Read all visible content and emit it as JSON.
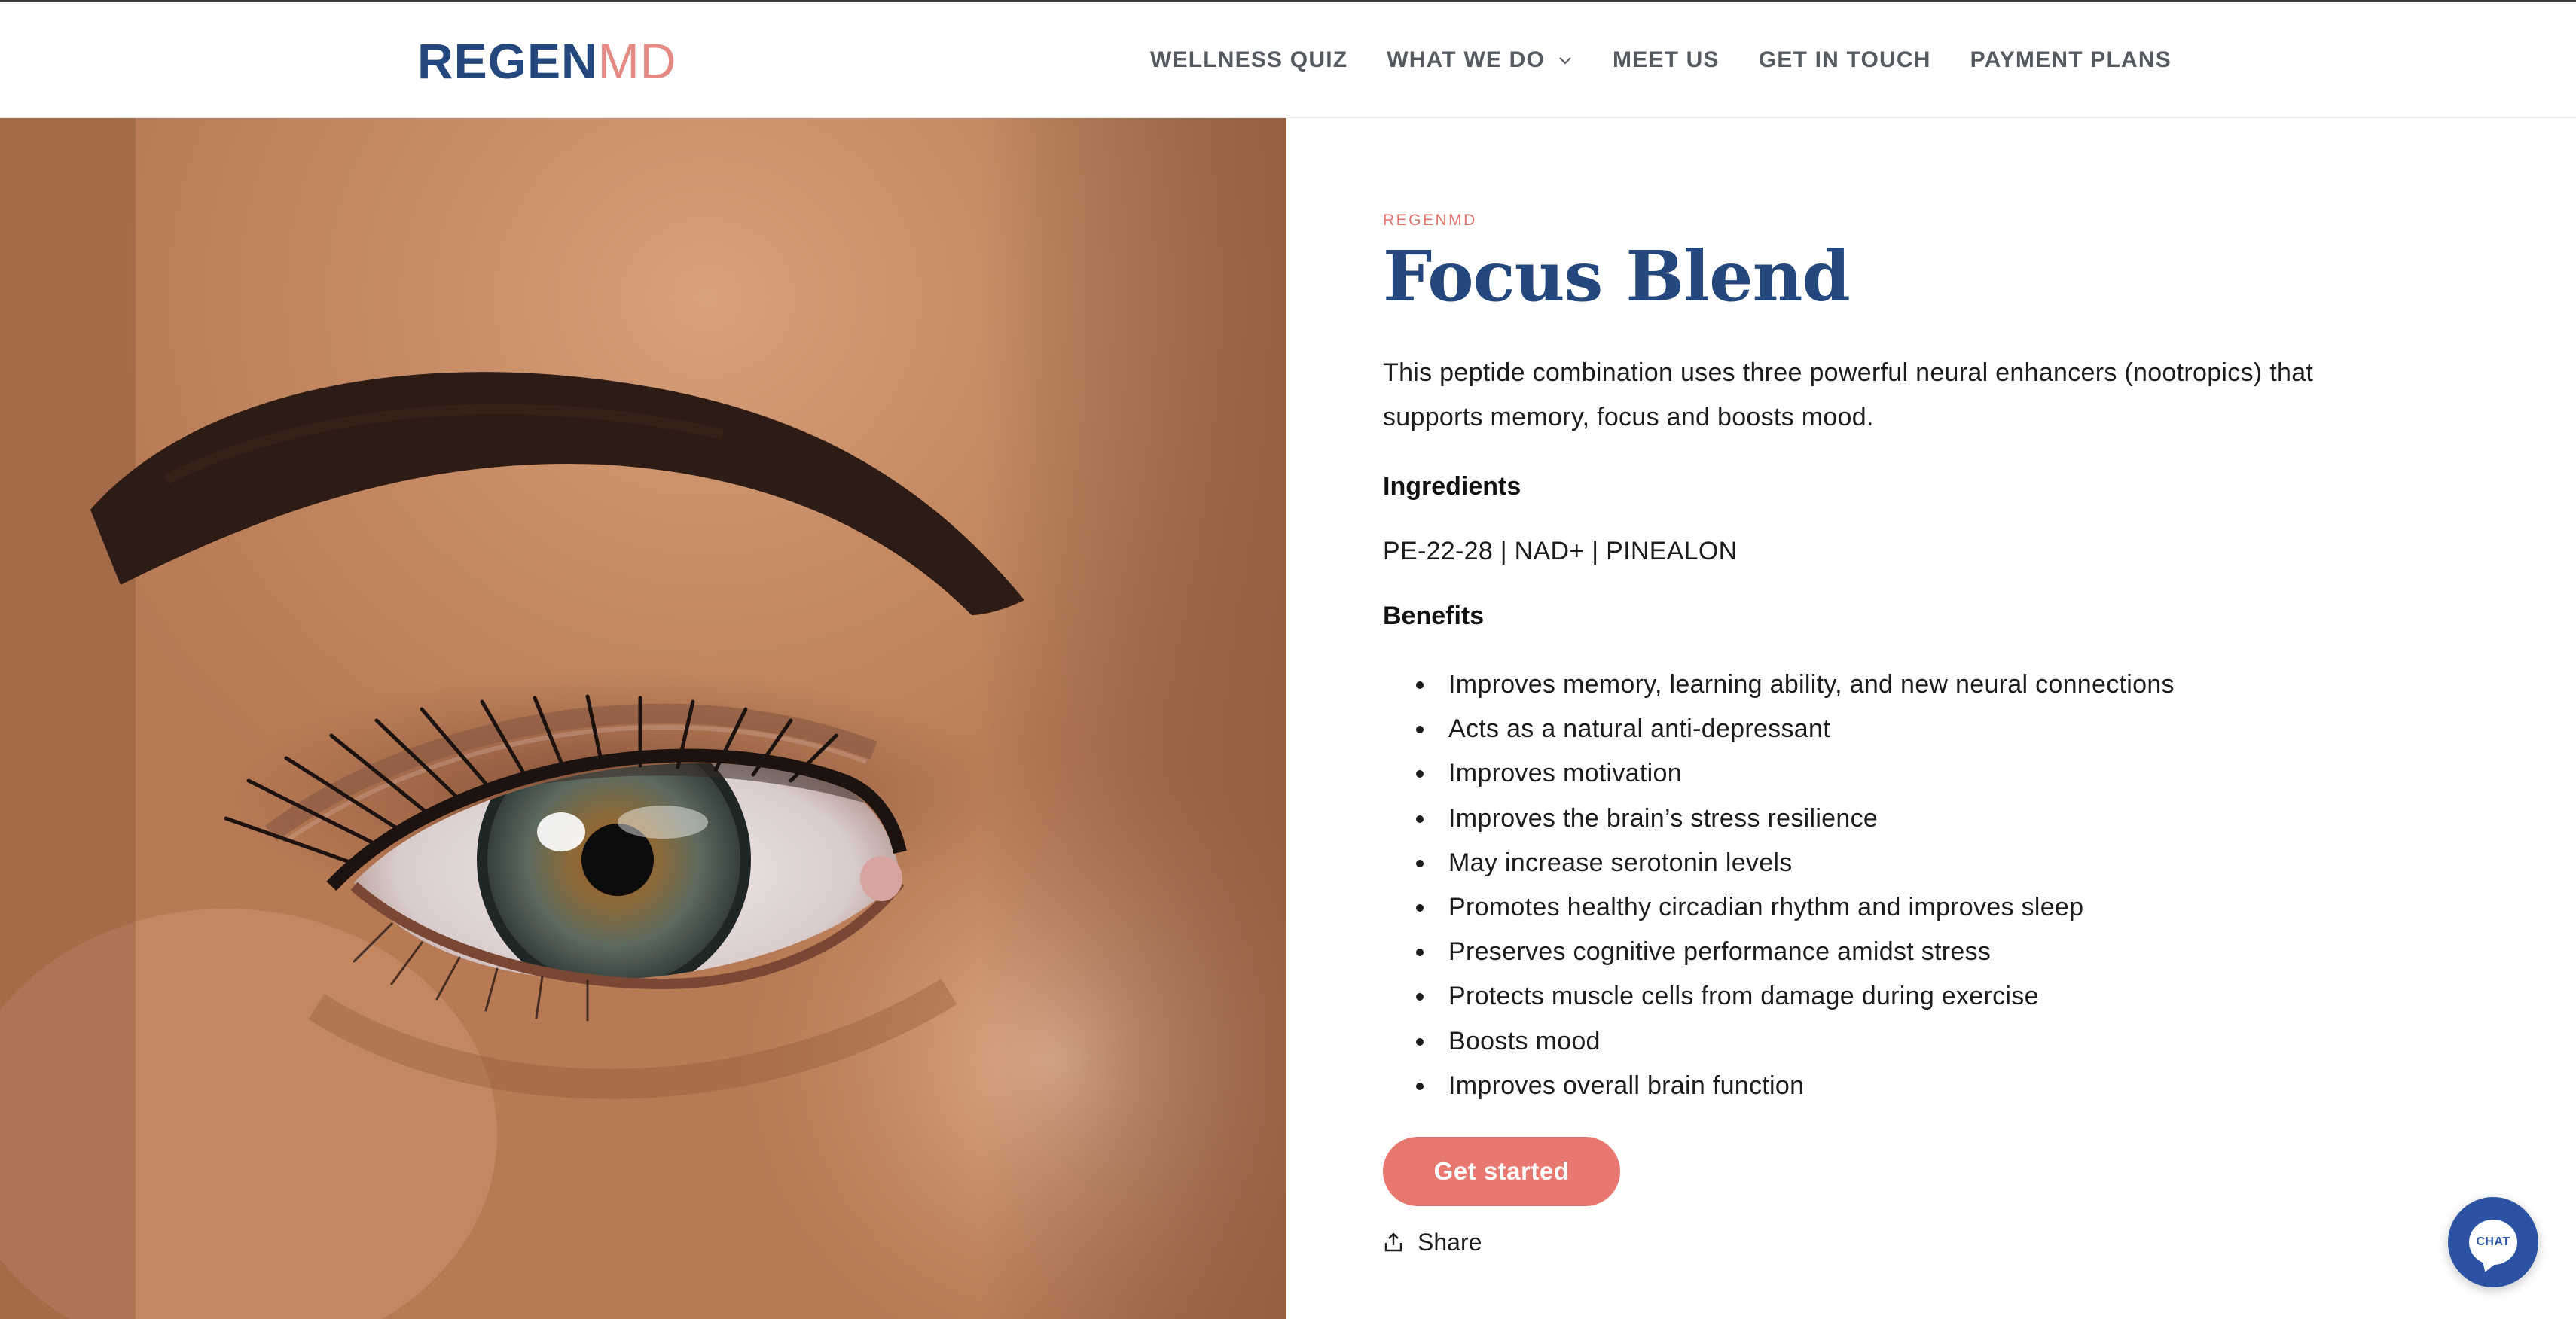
{
  "header": {
    "logo": {
      "part1": "REGEN",
      "part2": "MD"
    },
    "nav": [
      {
        "label": "WELLNESS QUIZ"
      },
      {
        "label": "WHAT WE DO",
        "has_dropdown": true
      },
      {
        "label": "MEET US"
      },
      {
        "label": "GET IN TOUCH"
      },
      {
        "label": "PAYMENT PLANS"
      }
    ]
  },
  "product": {
    "vendor": "REGENMD",
    "title": "Focus Blend",
    "description": "This peptide combination uses three powerful neural enhancers (nootropics) that supports memory, focus and boosts mood.",
    "ingredients_heading": "Ingredients",
    "ingredients": "PE-22-28 | NAD+ | PINEALON",
    "benefits_heading": "Benefits",
    "benefits": [
      "Improves memory, learning ability, and new neural connections",
      "Acts as a natural anti-depressant",
      "Improves motivation",
      "Improves the brain’s stress resilience",
      "May increase serotonin levels",
      "Promotes healthy circadian rhythm and improves sleep",
      "Preserves cognitive performance amidst stress",
      "Protects muscle cells from damage during exercise",
      "Boosts mood",
      "Improves overall brain function"
    ],
    "cta_label": "Get started",
    "share_label": "Share"
  },
  "hero_image": {
    "subject": "close-up-eye-photo"
  },
  "chat_widget": {
    "label": "CHAT"
  },
  "colors": {
    "brand_navy": "#24477e",
    "brand_coral": "#e8776f",
    "chat_blue": "#2c53a3"
  }
}
